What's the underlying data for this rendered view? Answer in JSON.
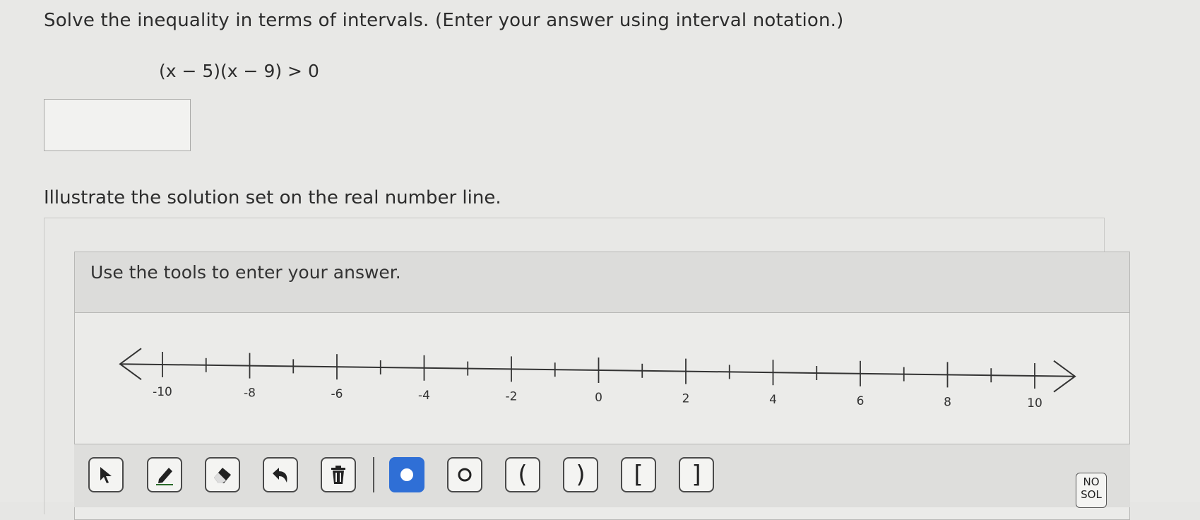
{
  "question": {
    "title": "Solve the inequality in terms of intervals. (Enter your answer using interval notation.)",
    "equation": "(x − 5)(x − 9) > 0",
    "answer_value": ""
  },
  "illustrate": {
    "title": "Illustrate the solution set on the real number line.",
    "panel_header": "Use the tools to enter your answer."
  },
  "number_line": {
    "min": -10,
    "max": 10,
    "labels": [
      "-10",
      "-8",
      "-6",
      "-4",
      "-2",
      "0",
      "2",
      "4",
      "6",
      "8",
      "10"
    ]
  },
  "toolbar": {
    "tools": [
      {
        "name": "pointer-tool-button",
        "icon": "cursor-arrow-icon"
      },
      {
        "name": "pencil-tool-button",
        "icon": "pencil-icon"
      },
      {
        "name": "eraser-tool-button",
        "icon": "eraser-icon"
      },
      {
        "name": "undo-tool-button",
        "icon": "undo-icon"
      },
      {
        "name": "trash-tool-button",
        "icon": "trash-icon"
      },
      {
        "name": "closed-dot-tool-button",
        "icon": "filled-dot-icon"
      },
      {
        "name": "open-dot-tool-button",
        "icon": "open-dot-icon"
      },
      {
        "name": "left-paren-tool-button",
        "icon": "left-paren-icon",
        "glyph": "("
      },
      {
        "name": "right-paren-tool-button",
        "icon": "right-paren-icon",
        "glyph": ")"
      },
      {
        "name": "left-bracket-tool-button",
        "icon": "left-bracket-icon",
        "glyph": "["
      },
      {
        "name": "right-bracket-tool-button",
        "icon": "right-bracket-icon",
        "glyph": "]"
      }
    ],
    "no_solution_label_1": "NO",
    "no_solution_label_2": "SOL",
    "active_color": "#2f6fd6"
  }
}
